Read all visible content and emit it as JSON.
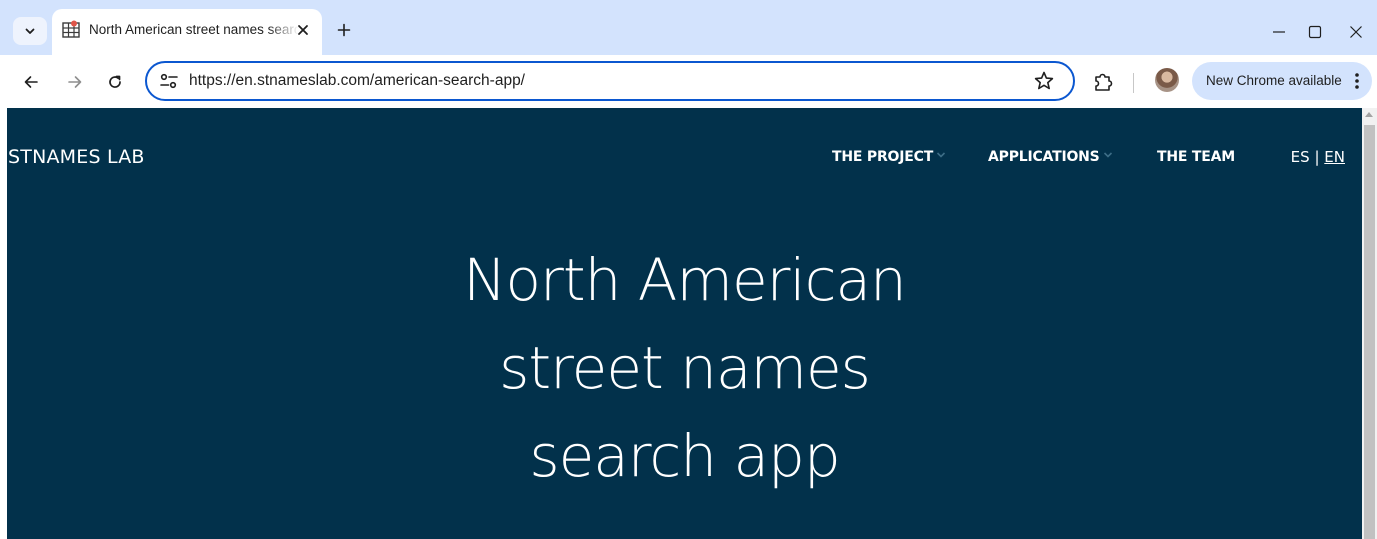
{
  "browser": {
    "tab": {
      "title": "North American street names search app",
      "favicon": "map-grid-icon"
    },
    "icons": {
      "tab_menu": "chevron-down-icon",
      "close_tab": "close-icon",
      "new_tab": "plus-icon",
      "minimize": "minimize-icon",
      "maximize": "maximize-icon",
      "close_window": "close-icon",
      "back": "arrow-left-icon",
      "forward": "arrow-right-icon",
      "reload": "reload-icon",
      "site_info": "tune-icon",
      "bookmark": "star-icon",
      "extensions": "puzzle-icon",
      "menu": "kebab-icon"
    },
    "address_bar": {
      "url": "https://en.stnameslab.com/american-search-app/"
    },
    "update_button": {
      "label": "New Chrome available"
    },
    "colors": {
      "tabbar_bg": "#d3e3fd",
      "omnibox_border": "#0b57d0"
    }
  },
  "site": {
    "brand": "STNAMES LAB",
    "nav": [
      {
        "label": "THE PROJECT",
        "has_dropdown": true
      },
      {
        "label": "APPLICATIONS",
        "has_dropdown": true
      },
      {
        "label": "THE TEAM",
        "has_dropdown": false
      }
    ],
    "language": {
      "es": "ES",
      "separator": "|",
      "en": "EN",
      "active": "EN"
    },
    "hero": {
      "lines": [
        "North American",
        "street names",
        "search app"
      ]
    },
    "colors": {
      "background": "#02314b",
      "text": "#ffffff"
    }
  }
}
